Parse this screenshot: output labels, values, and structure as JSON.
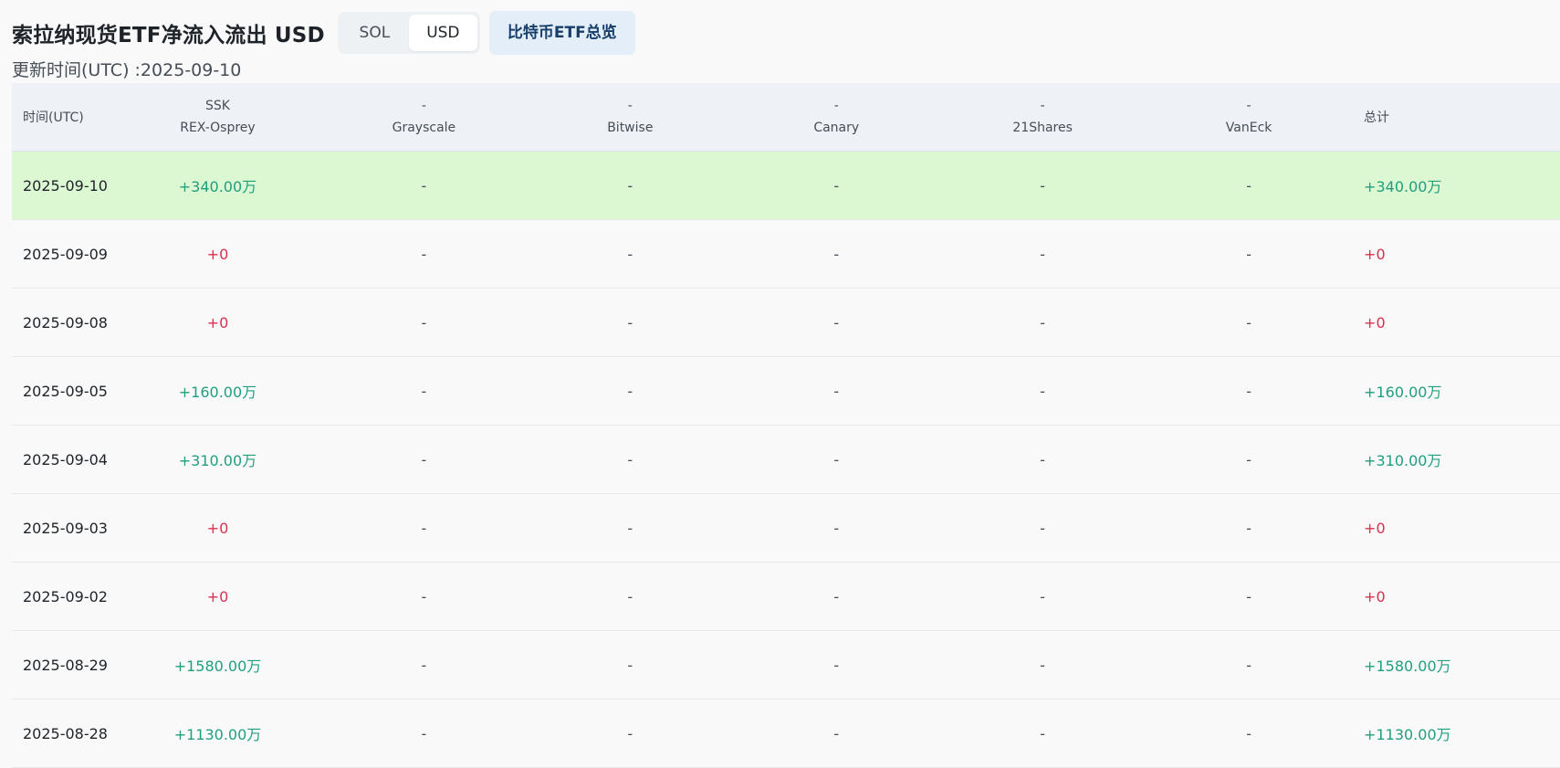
{
  "header": {
    "title": "索拉纳现货ETF净流入流出 USD",
    "currency_toggle": [
      {
        "label": "SOL",
        "active": false
      },
      {
        "label": "USD",
        "active": true
      }
    ],
    "overview_button": "比特币ETF总览",
    "updated_text": "更新时间(UTC) :2025-09-10"
  },
  "table": {
    "date_header": "时间(UTC)",
    "total_header": "总计",
    "providers": [
      {
        "ticker": "SSK",
        "issuer": "REX-Osprey"
      },
      {
        "ticker": "-",
        "issuer": "Grayscale"
      },
      {
        "ticker": "-",
        "issuer": "Bitwise"
      },
      {
        "ticker": "-",
        "issuer": "Canary"
      },
      {
        "ticker": "-",
        "issuer": "21Shares"
      },
      {
        "ticker": "-",
        "issuer": "VanEck"
      }
    ],
    "rows": [
      {
        "date": "2025-09-10",
        "values": [
          "+340.00万",
          "-",
          "-",
          "-",
          "-",
          "-"
        ],
        "total": "+340.00万",
        "highlight": true
      },
      {
        "date": "2025-09-09",
        "values": [
          "+0",
          "-",
          "-",
          "-",
          "-",
          "-"
        ],
        "total": "+0",
        "highlight": false
      },
      {
        "date": "2025-09-08",
        "values": [
          "+0",
          "-",
          "-",
          "-",
          "-",
          "-"
        ],
        "total": "+0",
        "highlight": false
      },
      {
        "date": "2025-09-05",
        "values": [
          "+160.00万",
          "-",
          "-",
          "-",
          "-",
          "-"
        ],
        "total": "+160.00万",
        "highlight": false
      },
      {
        "date": "2025-09-04",
        "values": [
          "+310.00万",
          "-",
          "-",
          "-",
          "-",
          "-"
        ],
        "total": "+310.00万",
        "highlight": false
      },
      {
        "date": "2025-09-03",
        "values": [
          "+0",
          "-",
          "-",
          "-",
          "-",
          "-"
        ],
        "total": "+0",
        "highlight": false
      },
      {
        "date": "2025-09-02",
        "values": [
          "+0",
          "-",
          "-",
          "-",
          "-",
          "-"
        ],
        "total": "+0",
        "highlight": false
      },
      {
        "date": "2025-08-29",
        "values": [
          "+1580.00万",
          "-",
          "-",
          "-",
          "-",
          "-"
        ],
        "total": "+1580.00万",
        "highlight": false
      },
      {
        "date": "2025-08-28",
        "values": [
          "+1130.00万",
          "-",
          "-",
          "-",
          "-",
          "-"
        ],
        "total": "+1130.00万",
        "highlight": false
      }
    ]
  },
  "colors": {
    "positive": "#1f9f7e",
    "zero": "#d9304e",
    "highlight_row": "#dbf8d2",
    "overview_button_bg": "#e3eef9"
  }
}
